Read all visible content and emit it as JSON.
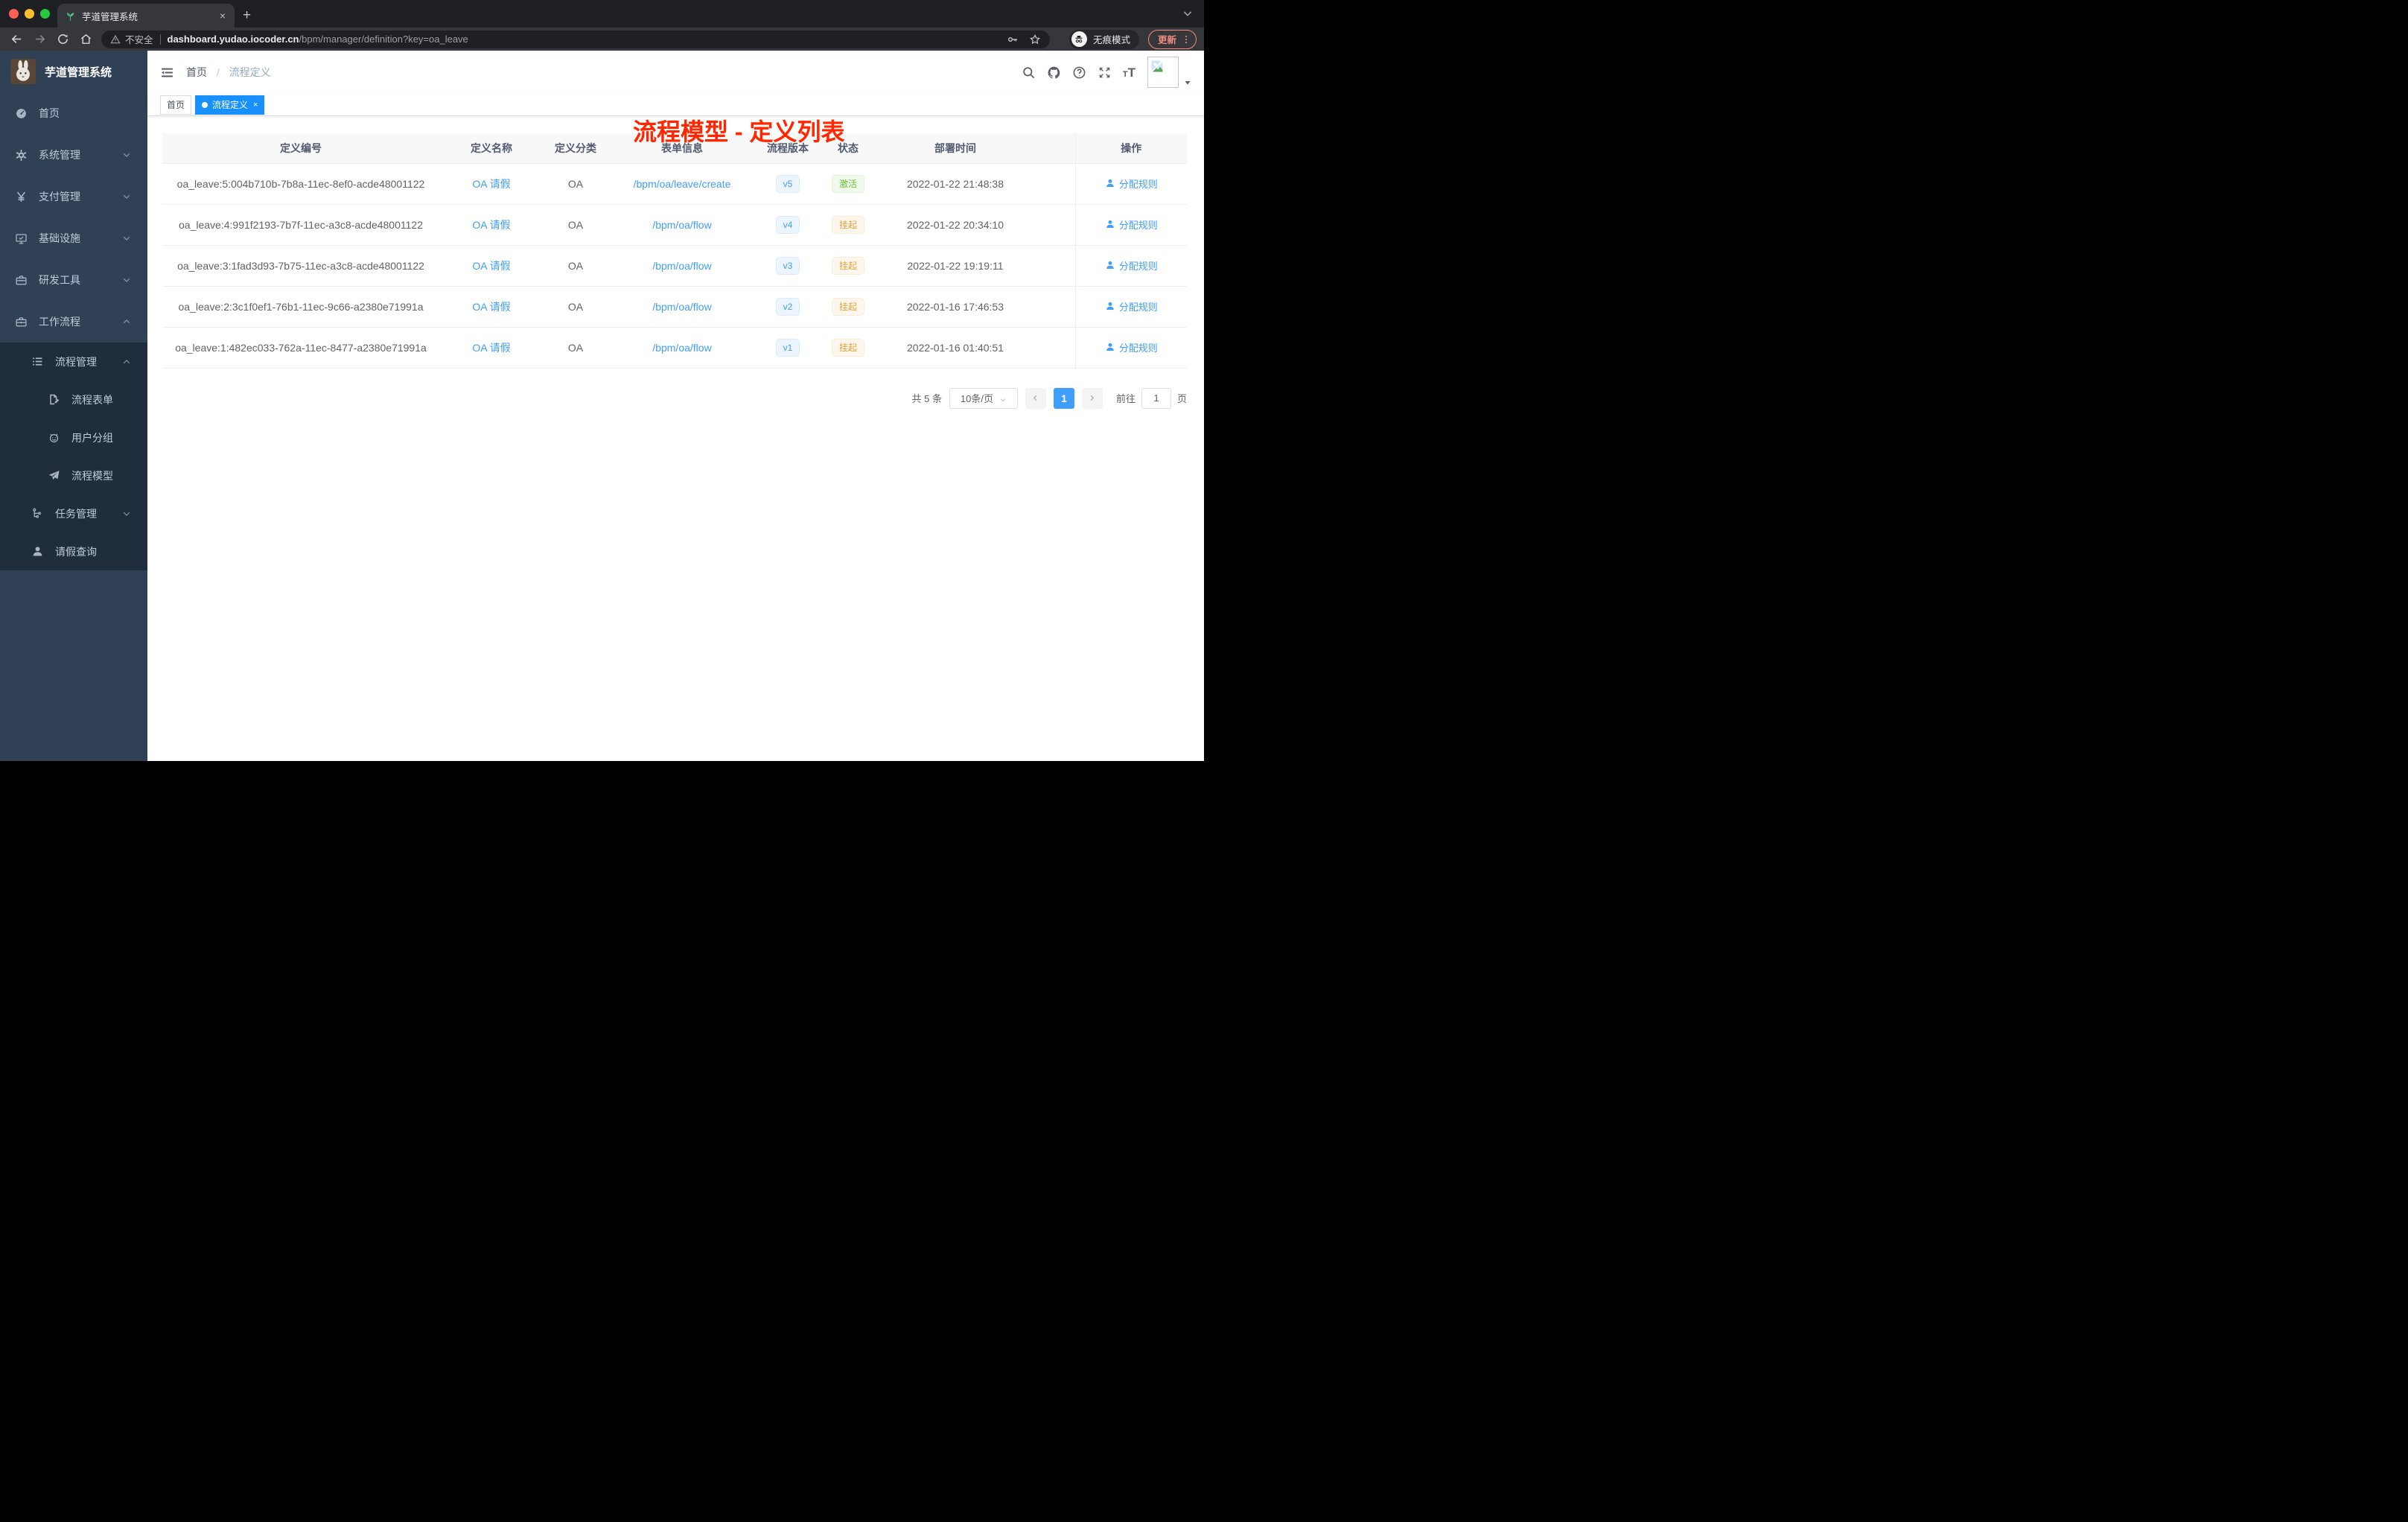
{
  "browser": {
    "tab": {
      "title": "芋道管理系统",
      "close_glyph": "×",
      "new_tab_glyph": "+"
    },
    "toolbar": {
      "security_warning": "不安全",
      "url_domain": "dashboard.yudao.iocoder.cn",
      "url_path": "/bpm/manager/definition?key=oa_leave",
      "incognito_label": "无痕模式",
      "update_label": "更新"
    }
  },
  "sidebar": {
    "logo_title": "芋道管理系统",
    "items": [
      {
        "key": "home",
        "label": "首页",
        "icon": "dashboard-icon",
        "indent": 1,
        "arrow": null,
        "dark": false
      },
      {
        "key": "system",
        "label": "系统管理",
        "icon": "gear-icon",
        "indent": 1,
        "arrow": "down",
        "dark": false
      },
      {
        "key": "payment",
        "label": "支付管理",
        "icon": "yen-icon",
        "indent": 1,
        "arrow": "down",
        "dark": false
      },
      {
        "key": "infra",
        "label": "基础设施",
        "icon": "monitor-icon",
        "indent": 1,
        "arrow": "down",
        "dark": false
      },
      {
        "key": "dev-tools",
        "label": "研发工具",
        "icon": "toolbox-icon",
        "indent": 1,
        "arrow": "down",
        "dark": false
      },
      {
        "key": "workflow",
        "label": "工作流程",
        "icon": "briefcase-icon",
        "indent": 1,
        "arrow": "up",
        "dark": false
      },
      {
        "key": "process-mgmt",
        "label": "流程管理",
        "icon": "list-icon",
        "indent": 2,
        "arrow": "up",
        "dark": true
      },
      {
        "key": "process-form",
        "label": "流程表单",
        "icon": "form-icon",
        "indent": 3,
        "arrow": null,
        "dark": true
      },
      {
        "key": "user-group",
        "label": "用户分组",
        "icon": "robot-icon",
        "indent": 3,
        "arrow": null,
        "dark": true
      },
      {
        "key": "process-model",
        "label": "流程模型",
        "icon": "send-icon",
        "indent": 3,
        "arrow": null,
        "dark": true
      },
      {
        "key": "task-mgmt",
        "label": "任务管理",
        "icon": "tree-icon",
        "indent": 2,
        "arrow": "down",
        "dark": true
      },
      {
        "key": "leave-query",
        "label": "请假查询",
        "icon": "user-icon",
        "indent": 2,
        "arrow": null,
        "dark": true
      }
    ]
  },
  "header": {
    "breadcrumb": {
      "home": "首页",
      "current": "流程定义"
    },
    "annotation": "流程模型 - 定义列表"
  },
  "tags": [
    {
      "label": "首页",
      "active": false,
      "closable": false
    },
    {
      "label": "流程定义",
      "active": true,
      "closable": true
    }
  ],
  "table": {
    "columns": [
      "定义编号",
      "定义名称",
      "定义分类",
      "表单信息",
      "流程版本",
      "状态",
      "部署时间",
      "",
      "操作"
    ],
    "action_label": "分配规则",
    "rows": [
      {
        "id": "oa_leave:5:004b710b-7b8a-11ec-8ef0-acde48001122",
        "name": "OA 请假",
        "category": "OA",
        "form": "/bpm/oa/leave/create",
        "version": "v5",
        "status": "激活",
        "status_type": "success",
        "deploy_time": "2022-01-22 21:48:38"
      },
      {
        "id": "oa_leave:4:991f2193-7b7f-11ec-a3c8-acde48001122",
        "name": "OA 请假",
        "category": "OA",
        "form": "/bpm/oa/flow",
        "version": "v4",
        "status": "挂起",
        "status_type": "warning",
        "deploy_time": "2022-01-22 20:34:10"
      },
      {
        "id": "oa_leave:3:1fad3d93-7b75-11ec-a3c8-acde48001122",
        "name": "OA 请假",
        "category": "OA",
        "form": "/bpm/oa/flow",
        "version": "v3",
        "status": "挂起",
        "status_type": "warning",
        "deploy_time": "2022-01-22 19:19:11"
      },
      {
        "id": "oa_leave:2:3c1f0ef1-76b1-11ec-9c66-a2380e71991a",
        "name": "OA 请假",
        "category": "OA",
        "form": "/bpm/oa/flow",
        "version": "v2",
        "status": "挂起",
        "status_type": "warning",
        "deploy_time": "2022-01-16 17:46:53"
      },
      {
        "id": "oa_leave:1:482ec033-762a-11ec-8477-a2380e71991a",
        "name": "OA 请假",
        "category": "OA",
        "form": "/bpm/oa/flow",
        "version": "v1",
        "status": "挂起",
        "status_type": "warning",
        "deploy_time": "2022-01-16 01:40:51"
      }
    ]
  },
  "pagination": {
    "total_text": "共 5 条",
    "page_size": "10条/页",
    "current_page": "1",
    "goto_label": "前往",
    "goto_value": "1",
    "goto_suffix": "页"
  },
  "colors": {
    "link": "#409eff",
    "tag_active": "#1890ff",
    "status_active": "#67c23a",
    "status_suspended": "#e6a23c",
    "annotation_red": "#ff2600",
    "sidebar_bg": "#304156",
    "submenu_bg": "#1f2d3d"
  }
}
